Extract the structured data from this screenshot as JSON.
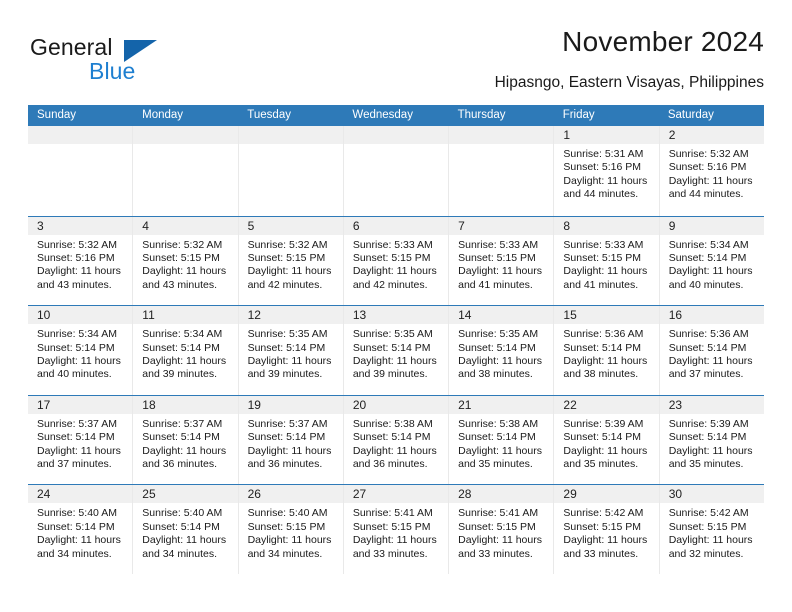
{
  "brand": {
    "name_top": "General",
    "name_bottom": "Blue",
    "accent_color": "#1e7fd0",
    "logo_triangle_color": "#1464aa"
  },
  "header": {
    "title": "November 2024",
    "subtitle": "Hipasngo, Eastern Visayas, Philippines"
  },
  "calendar": {
    "header_background": "#2e7ab8",
    "row_separator_color": "#2e7ab8",
    "day_band_background": "#f0f0f0",
    "weekdays": [
      "Sunday",
      "Monday",
      "Tuesday",
      "Wednesday",
      "Thursday",
      "Friday",
      "Saturday"
    ],
    "weeks": [
      [
        {
          "empty": true
        },
        {
          "empty": true
        },
        {
          "empty": true
        },
        {
          "empty": true
        },
        {
          "empty": true
        },
        {
          "day": "1",
          "sunrise": "Sunrise: 5:31 AM",
          "sunset": "Sunset: 5:16 PM",
          "daylight": "Daylight: 11 hours and 44 minutes."
        },
        {
          "day": "2",
          "sunrise": "Sunrise: 5:32 AM",
          "sunset": "Sunset: 5:16 PM",
          "daylight": "Daylight: 11 hours and 44 minutes."
        }
      ],
      [
        {
          "day": "3",
          "sunrise": "Sunrise: 5:32 AM",
          "sunset": "Sunset: 5:16 PM",
          "daylight": "Daylight: 11 hours and 43 minutes."
        },
        {
          "day": "4",
          "sunrise": "Sunrise: 5:32 AM",
          "sunset": "Sunset: 5:15 PM",
          "daylight": "Daylight: 11 hours and 43 minutes."
        },
        {
          "day": "5",
          "sunrise": "Sunrise: 5:32 AM",
          "sunset": "Sunset: 5:15 PM",
          "daylight": "Daylight: 11 hours and 42 minutes."
        },
        {
          "day": "6",
          "sunrise": "Sunrise: 5:33 AM",
          "sunset": "Sunset: 5:15 PM",
          "daylight": "Daylight: 11 hours and 42 minutes."
        },
        {
          "day": "7",
          "sunrise": "Sunrise: 5:33 AM",
          "sunset": "Sunset: 5:15 PM",
          "daylight": "Daylight: 11 hours and 41 minutes."
        },
        {
          "day": "8",
          "sunrise": "Sunrise: 5:33 AM",
          "sunset": "Sunset: 5:15 PM",
          "daylight": "Daylight: 11 hours and 41 minutes."
        },
        {
          "day": "9",
          "sunrise": "Sunrise: 5:34 AM",
          "sunset": "Sunset: 5:14 PM",
          "daylight": "Daylight: 11 hours and 40 minutes."
        }
      ],
      [
        {
          "day": "10",
          "sunrise": "Sunrise: 5:34 AM",
          "sunset": "Sunset: 5:14 PM",
          "daylight": "Daylight: 11 hours and 40 minutes."
        },
        {
          "day": "11",
          "sunrise": "Sunrise: 5:34 AM",
          "sunset": "Sunset: 5:14 PM",
          "daylight": "Daylight: 11 hours and 39 minutes."
        },
        {
          "day": "12",
          "sunrise": "Sunrise: 5:35 AM",
          "sunset": "Sunset: 5:14 PM",
          "daylight": "Daylight: 11 hours and 39 minutes."
        },
        {
          "day": "13",
          "sunrise": "Sunrise: 5:35 AM",
          "sunset": "Sunset: 5:14 PM",
          "daylight": "Daylight: 11 hours and 39 minutes."
        },
        {
          "day": "14",
          "sunrise": "Sunrise: 5:35 AM",
          "sunset": "Sunset: 5:14 PM",
          "daylight": "Daylight: 11 hours and 38 minutes."
        },
        {
          "day": "15",
          "sunrise": "Sunrise: 5:36 AM",
          "sunset": "Sunset: 5:14 PM",
          "daylight": "Daylight: 11 hours and 38 minutes."
        },
        {
          "day": "16",
          "sunrise": "Sunrise: 5:36 AM",
          "sunset": "Sunset: 5:14 PM",
          "daylight": "Daylight: 11 hours and 37 minutes."
        }
      ],
      [
        {
          "day": "17",
          "sunrise": "Sunrise: 5:37 AM",
          "sunset": "Sunset: 5:14 PM",
          "daylight": "Daylight: 11 hours and 37 minutes."
        },
        {
          "day": "18",
          "sunrise": "Sunrise: 5:37 AM",
          "sunset": "Sunset: 5:14 PM",
          "daylight": "Daylight: 11 hours and 36 minutes."
        },
        {
          "day": "19",
          "sunrise": "Sunrise: 5:37 AM",
          "sunset": "Sunset: 5:14 PM",
          "daylight": "Daylight: 11 hours and 36 minutes."
        },
        {
          "day": "20",
          "sunrise": "Sunrise: 5:38 AM",
          "sunset": "Sunset: 5:14 PM",
          "daylight": "Daylight: 11 hours and 36 minutes."
        },
        {
          "day": "21",
          "sunrise": "Sunrise: 5:38 AM",
          "sunset": "Sunset: 5:14 PM",
          "daylight": "Daylight: 11 hours and 35 minutes."
        },
        {
          "day": "22",
          "sunrise": "Sunrise: 5:39 AM",
          "sunset": "Sunset: 5:14 PM",
          "daylight": "Daylight: 11 hours and 35 minutes."
        },
        {
          "day": "23",
          "sunrise": "Sunrise: 5:39 AM",
          "sunset": "Sunset: 5:14 PM",
          "daylight": "Daylight: 11 hours and 35 minutes."
        }
      ],
      [
        {
          "day": "24",
          "sunrise": "Sunrise: 5:40 AM",
          "sunset": "Sunset: 5:14 PM",
          "daylight": "Daylight: 11 hours and 34 minutes."
        },
        {
          "day": "25",
          "sunrise": "Sunrise: 5:40 AM",
          "sunset": "Sunset: 5:14 PM",
          "daylight": "Daylight: 11 hours and 34 minutes."
        },
        {
          "day": "26",
          "sunrise": "Sunrise: 5:40 AM",
          "sunset": "Sunset: 5:15 PM",
          "daylight": "Daylight: 11 hours and 34 minutes."
        },
        {
          "day": "27",
          "sunrise": "Sunrise: 5:41 AM",
          "sunset": "Sunset: 5:15 PM",
          "daylight": "Daylight: 11 hours and 33 minutes."
        },
        {
          "day": "28",
          "sunrise": "Sunrise: 5:41 AM",
          "sunset": "Sunset: 5:15 PM",
          "daylight": "Daylight: 11 hours and 33 minutes."
        },
        {
          "day": "29",
          "sunrise": "Sunrise: 5:42 AM",
          "sunset": "Sunset: 5:15 PM",
          "daylight": "Daylight: 11 hours and 33 minutes."
        },
        {
          "day": "30",
          "sunrise": "Sunrise: 5:42 AM",
          "sunset": "Sunset: 5:15 PM",
          "daylight": "Daylight: 11 hours and 32 minutes."
        }
      ]
    ]
  }
}
